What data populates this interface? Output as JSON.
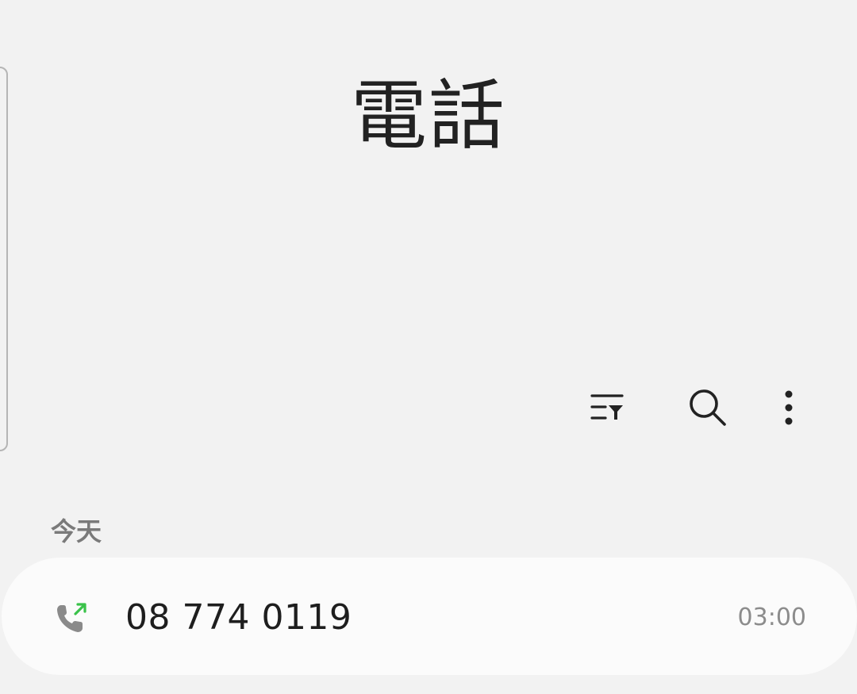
{
  "header": {
    "title": "電話"
  },
  "toolbar": {
    "filter_icon": "filter-list-icon",
    "search_icon": "search-icon",
    "more_icon": "more-vertical-icon"
  },
  "log": {
    "section_label": "今天",
    "entries": [
      {
        "number": "08 774 0119",
        "time": "03:00",
        "call_type_icon": "outgoing-call-icon",
        "accent_color": "#3ac24a"
      }
    ]
  }
}
